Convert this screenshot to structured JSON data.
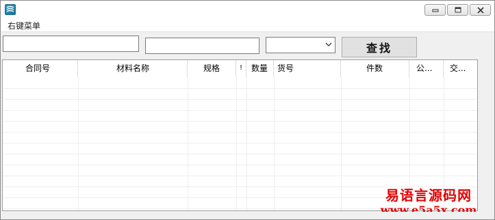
{
  "window": {
    "menu": {
      "context_menu_label": "右键菜单"
    }
  },
  "search": {
    "field1_value": "",
    "field2_value": "",
    "dropdown_selected": "",
    "button_label": "查找"
  },
  "grid": {
    "columns": [
      "合同号",
      "材料名称",
      "规格",
      "!",
      "数量",
      "货号",
      "件数",
      "公...",
      "交..."
    ],
    "rows": []
  },
  "watermark": {
    "line1": "易语言源码网",
    "line2": "www.e5a5x.com"
  },
  "colors": {
    "watermark": "#e30000",
    "grid_lines": "#eeeeee",
    "background": "#f0f0f0"
  },
  "icons": [
    "app-icon",
    "minimize-icon",
    "maximize-icon",
    "close-icon",
    "chevron-down-icon"
  ]
}
